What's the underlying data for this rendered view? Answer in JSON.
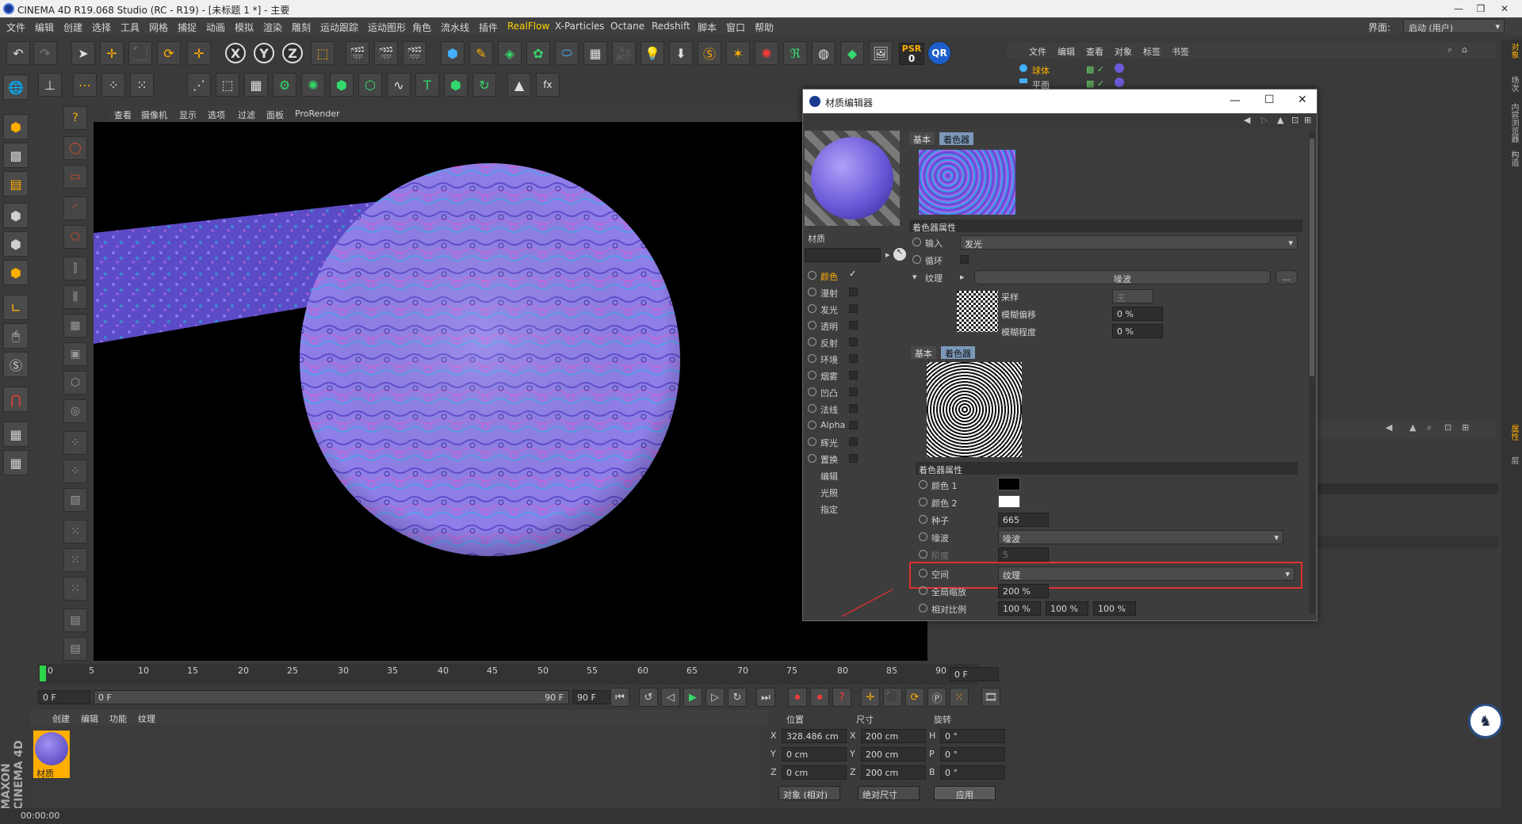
{
  "window": {
    "title": "CINEMA 4D R19.068 Studio (RC - R19) - [未标题 1 *] - 主要"
  },
  "menu": {
    "items": [
      "文件",
      "编辑",
      "创建",
      "选择",
      "工具",
      "网格",
      "捕捉",
      "动画",
      "模拟",
      "渲染",
      "雕刻",
      "运动跟踪",
      "运动图形",
      "角色",
      "流水线",
      "插件",
      "RealFlow",
      "X-Particles",
      "Octane",
      "Redshift",
      "脚本",
      "窗口",
      "帮助"
    ],
    "interface_label": "界面:",
    "interface_value": "启动 (用户)"
  },
  "toolbar": {
    "psr_label": "PSR",
    "psr_value": "0"
  },
  "viewport": {
    "menu": [
      "查看",
      "摄像机",
      "显示",
      "选项",
      "过滤",
      "面板",
      "ProRender"
    ]
  },
  "timeline": {
    "ticks": [
      "0",
      "5",
      "10",
      "15",
      "20",
      "25",
      "30",
      "35",
      "40",
      "45",
      "50",
      "55",
      "60",
      "65",
      "70",
      "75",
      "80",
      "85",
      "90"
    ],
    "frame_end_field": "0 F",
    "start": "0 F",
    "range_start": "0 F",
    "range_end": "90 F",
    "end": "90 F"
  },
  "material_manager": {
    "menu": [
      "创建",
      "编辑",
      "功能",
      "纹理"
    ],
    "material_name": "材质"
  },
  "coordinates": {
    "headers": [
      "位置",
      "尺寸",
      "旋转"
    ],
    "rows": [
      {
        "axis": "X",
        "pos": "328.486 cm",
        "size_axis": "X",
        "size": "200 cm",
        "rot_axis": "H",
        "rot": "0 °"
      },
      {
        "axis": "Y",
        "pos": "0 cm",
        "size_axis": "Y",
        "size": "200 cm",
        "rot_axis": "P",
        "rot": "0 °"
      },
      {
        "axis": "Z",
        "pos": "0 cm",
        "size_axis": "Z",
        "size": "200 cm",
        "rot_axis": "B",
        "rot": "0 °"
      }
    ],
    "mode": "对象 (相对)",
    "size_mode": "绝对尺寸",
    "apply": "应用"
  },
  "status": {
    "time": "00:00:00"
  },
  "object_manager": {
    "menu": [
      "文件",
      "编辑",
      "查看",
      "对象",
      "标签",
      "书签"
    ],
    "objects": [
      "球体",
      "平面"
    ]
  },
  "right_tabs": [
    "对象",
    "场次",
    "内容浏览器",
    "构造",
    "属性",
    "层"
  ],
  "material_editor": {
    "title": "材质编辑器",
    "material_name": "材质",
    "channels": [
      {
        "name": "颜色",
        "checked": true
      },
      {
        "name": "漫射",
        "checked": false
      },
      {
        "name": "发光",
        "checked": false
      },
      {
        "name": "透明",
        "checked": false
      },
      {
        "name": "反射",
        "checked": false
      },
      {
        "name": "环境",
        "checked": false
      },
      {
        "name": "烟雾",
        "checked": false
      },
      {
        "name": "凹凸",
        "checked": false
      },
      {
        "name": "法线",
        "checked": false
      },
      {
        "name": "Alpha",
        "checked": false
      },
      {
        "name": "辉光",
        "checked": false
      },
      {
        "name": "置换",
        "checked": false
      }
    ],
    "extra_items": [
      "编辑",
      "光照",
      "指定"
    ],
    "tabs": [
      "基本",
      "着色器"
    ],
    "shader_props_title": "着色器属性",
    "input_label": "输入",
    "input_value": "发光",
    "loop_label": "循环",
    "texture_label": "纹理",
    "texture_value": "噪波",
    "more_btn": "...",
    "sample_label": "采样",
    "sample_value": "无",
    "blur_offset_label": "模糊偏移",
    "blur_offset_value": "0 %",
    "blur_amount_label": "模糊程度",
    "blur_amount_value": "0 %",
    "inner_tabs": [
      "基本",
      "着色器"
    ],
    "inner_props_title": "着色器属性",
    "color1_label": "颜色 1",
    "color1": "#000000",
    "color2_label": "颜色 2",
    "color2": "#ffffff",
    "seed_label": "种子",
    "seed_value": "665",
    "noise_label": "噪波",
    "noise_value": "噪波",
    "octaves_label": "阶度",
    "octaves_value": "5",
    "space_label": "空间",
    "space_value": "纹理",
    "global_scale_label": "全局缩放",
    "global_scale_value": "200 %",
    "relative_scale_label": "相对比例",
    "relative_scale_values": [
      "100 %",
      "100 %",
      "100 %"
    ]
  },
  "colors": {
    "accent": "#ffae00",
    "highlight_box": "#e03030",
    "selection_blue": "#7b98b8"
  }
}
